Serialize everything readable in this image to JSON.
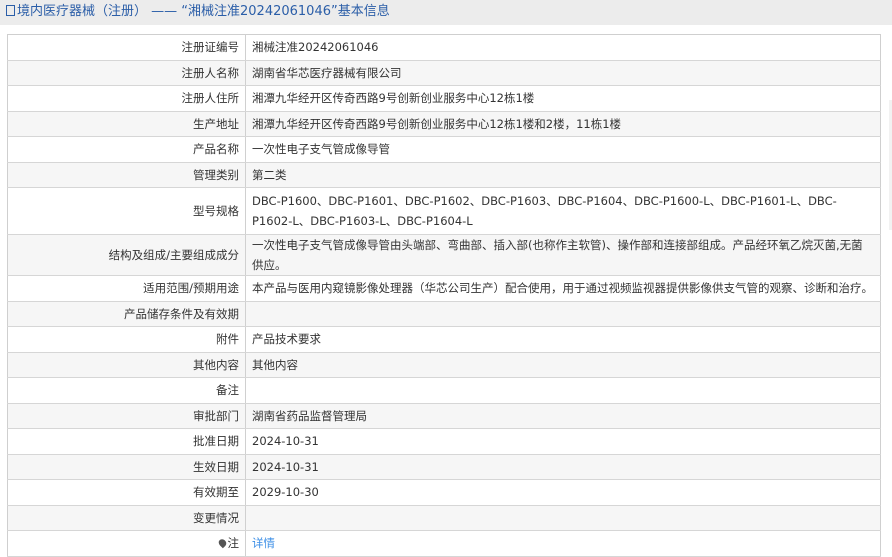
{
  "title": "境内医疗器械（注册） —— “湘械注准20242061046”基本信息",
  "rows": [
    {
      "label": "注册证编号",
      "value": "湘械注准20242061046"
    },
    {
      "label": "注册人名称",
      "value": "湖南省华芯医疗器械有限公司"
    },
    {
      "label": "注册人住所",
      "value": "湘潭九华经开区传奇西路9号创新创业服务中心12栋1楼"
    },
    {
      "label": "生产地址",
      "value": "湘潭九华经开区传奇西路9号创新创业服务中心12栋1楼和2楼，11栋1楼"
    },
    {
      "label": "产品名称",
      "value": "一次性电子支气管成像导管"
    },
    {
      "label": "管理类别",
      "value": "第二类"
    },
    {
      "label": "型号规格",
      "value": "DBC-P1600、DBC-P1601、DBC-P1602、DBC-P1603、DBC-P1604、DBC-P1600-L、DBC-P1601-L、DBC-P1602-L、DBC-P1603-L、DBC-P1604-L"
    },
    {
      "label": "结构及组成/主要组成成分",
      "value": "一次性电子支气管成像导管由头端部、弯曲部、插入部(也称作主软管)、操作部和连接部组成。产品经环氧乙烷灭菌,无菌供应。"
    },
    {
      "label": "适用范围/预期用途",
      "value": "本产品与医用内窥镜影像处理器（华芯公司生产）配合使用，用于通过视频监视器提供影像供支气管的观察、诊断和治疗。"
    },
    {
      "label": "产品储存条件及有效期",
      "value": ""
    },
    {
      "label": "附件",
      "value": "产品技术要求"
    },
    {
      "label": "其他内容",
      "value": "其他内容"
    },
    {
      "label": "备注",
      "value": ""
    },
    {
      "label": "审批部门",
      "value": "湖南省药品监督管理局"
    },
    {
      "label": "批准日期",
      "value": "2024-10-31"
    },
    {
      "label": "生效日期",
      "value": "2024-10-31"
    },
    {
      "label": "有效期至",
      "value": "2029-10-30"
    },
    {
      "label": "变更情况",
      "value": ""
    }
  ],
  "note": {
    "label": "注",
    "link": "详情"
  }
}
